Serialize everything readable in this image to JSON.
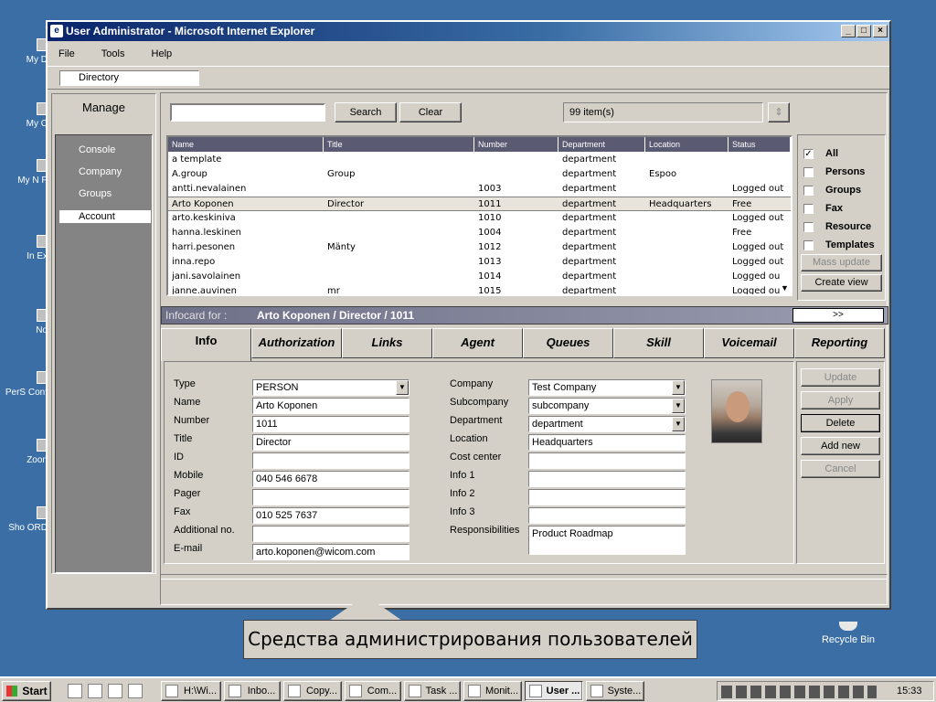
{
  "desktop": {
    "icons": [
      "My D",
      "My C",
      "My N P",
      "In Ex",
      "No",
      "PerS Cont",
      "Zoon",
      "Sho ORD"
    ],
    "recycle_bin": "Recycle Bin"
  },
  "window": {
    "title": "User Administrator - Microsoft Internet Explorer",
    "menu": [
      "File",
      "Tools",
      "Help"
    ],
    "address": "Directory"
  },
  "sidebar": {
    "title": "Manage",
    "items": [
      {
        "label": "Console"
      },
      {
        "label": "Company"
      },
      {
        "label": "Groups"
      },
      {
        "label": "Account",
        "selected": true
      }
    ]
  },
  "search": {
    "value": "",
    "search_label": "Search",
    "clear_label": "Clear",
    "count": "99 item(s)"
  },
  "grid": {
    "columns": [
      "Name",
      "Title",
      "Number",
      "Department",
      "Location",
      "Status"
    ],
    "rows": [
      [
        "a template",
        "",
        "",
        "department",
        "",
        ""
      ],
      [
        "A.group",
        "Group",
        "",
        "department",
        "Espoo",
        ""
      ],
      [
        "antti.nevalainen",
        "",
        "1003",
        "department",
        "",
        "Logged out"
      ],
      [
        "Arto Koponen",
        "Director",
        "1011",
        "department",
        "Headquarters",
        "Free"
      ],
      [
        "arto.keskiniva",
        "",
        "1010",
        "department",
        "",
        "Logged out"
      ],
      [
        "hanna.leskinen",
        "",
        "1004",
        "department",
        "",
        "Free"
      ],
      [
        "harri.pesonen",
        "Mänty",
        "1012",
        "department",
        "",
        "Logged out"
      ],
      [
        "inna.repo",
        "",
        "1013",
        "department",
        "",
        "Logged out"
      ],
      [
        "jani.savolainen",
        "",
        "1014",
        "department",
        "",
        "Logged ou"
      ],
      [
        "janne.auvinen",
        "mr",
        "1015",
        "department",
        "",
        "Logged ou"
      ]
    ],
    "selected_row": 3
  },
  "filters": {
    "items": [
      {
        "label": "All",
        "checked": true
      },
      {
        "label": "Persons",
        "checked": false
      },
      {
        "label": "Groups",
        "checked": false
      },
      {
        "label": "Fax",
        "checked": false
      },
      {
        "label": "Resource",
        "checked": false
      },
      {
        "label": "Templates",
        "checked": false
      }
    ],
    "mass_update": "Mass update",
    "create_view": "Create view"
  },
  "infocard": {
    "label": "Infocard for :",
    "subject": "Arto Koponen / Director / 1011",
    "expand": ">>"
  },
  "tabs": [
    "Info",
    "Authorization",
    "Links",
    "Agent",
    "Queues",
    "Skill",
    "Voicemail",
    "Reporting"
  ],
  "form": {
    "left": [
      {
        "label": "Type",
        "value": "PERSON",
        "dropdown": true
      },
      {
        "label": "Name",
        "value": "Arto Koponen"
      },
      {
        "label": "Number",
        "value": "1011"
      },
      {
        "label": "Title",
        "value": "Director"
      },
      {
        "label": "ID",
        "value": ""
      },
      {
        "label": "Mobile",
        "value": "040 546 6678"
      },
      {
        "label": "Pager",
        "value": ""
      },
      {
        "label": "Fax",
        "value": "010 525 7637"
      },
      {
        "label": "Additional no.",
        "value": ""
      },
      {
        "label": "E-mail",
        "value": "arto.koponen@wicom.com"
      }
    ],
    "right": [
      {
        "label": "Company",
        "value": "Test Company",
        "dropdown": true
      },
      {
        "label": "Subcompany",
        "value": "subcompany",
        "dropdown": true
      },
      {
        "label": "Department",
        "value": "department",
        "dropdown": true
      },
      {
        "label": "Location",
        "value": "Headquarters"
      },
      {
        "label": "Cost center",
        "value": ""
      },
      {
        "label": "Info 1",
        "value": ""
      },
      {
        "label": "Info 2",
        "value": ""
      },
      {
        "label": "Info 3",
        "value": ""
      },
      {
        "label": "Responsibilities",
        "value": "Product Roadmap"
      }
    ]
  },
  "actions": {
    "update": "Update",
    "apply": "Apply",
    "delete": "Delete",
    "add_new": "Add new",
    "cancel": "Cancel"
  },
  "caption": "Средства администрирования пользователей",
  "taskbar": {
    "start": "Start",
    "tasks": [
      "H:\\Wi...",
      "Inbo...",
      "Copy...",
      "Com...",
      "Task ...",
      "Monit...",
      "User ...",
      "Syste..."
    ],
    "active_task": 6,
    "clock": "15:33"
  }
}
